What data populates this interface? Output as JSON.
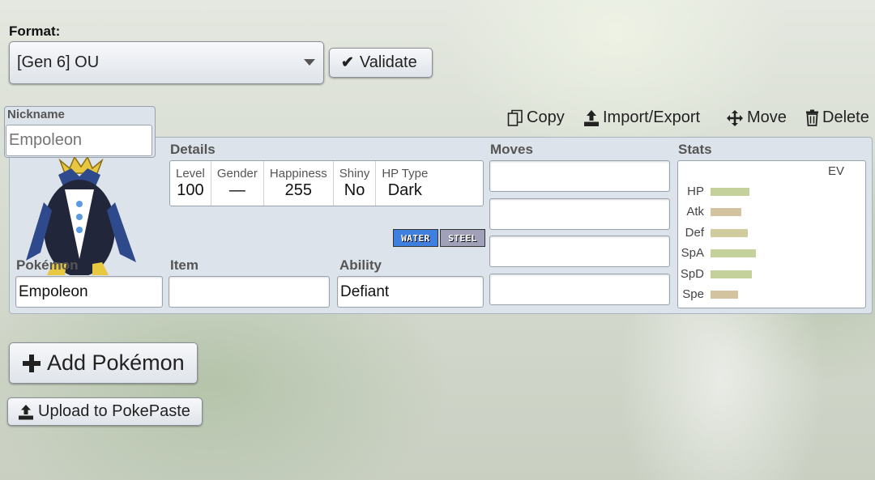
{
  "format": {
    "label": "Format:",
    "selected": "[Gen 6] OU"
  },
  "validate": {
    "label": "Validate"
  },
  "nickname": {
    "label": "Nickname",
    "placeholder": "Empoleon"
  },
  "toolbar": {
    "copy": "Copy",
    "import_export": "Import/Export",
    "move": "Move",
    "delete": "Delete"
  },
  "details": {
    "label": "Details",
    "level": {
      "label": "Level",
      "value": "100"
    },
    "gender": {
      "label": "Gender",
      "value": "—"
    },
    "happiness": {
      "label": "Happiness",
      "value": "255"
    },
    "shiny": {
      "label": "Shiny",
      "value": "No"
    },
    "hptype": {
      "label": "HP Type",
      "value": "Dark"
    }
  },
  "types": [
    {
      "name": "WATER",
      "color": "#3f7fe0"
    },
    {
      "name": "STEEL",
      "color": "#a0a0b8"
    }
  ],
  "pokemon": {
    "label": "Pokémon",
    "value": "Empoleon"
  },
  "item": {
    "label": "Item",
    "value": ""
  },
  "ability": {
    "label": "Ability",
    "value": "Defiant"
  },
  "moves": {
    "label": "Moves",
    "values": [
      "",
      "",
      "",
      ""
    ]
  },
  "stats": {
    "label": "Stats",
    "ev_header": "EV",
    "rows": [
      {
        "name": "HP",
        "level": 0.58,
        "color": "#c5d19a"
      },
      {
        "name": "Atk",
        "level": 0.46,
        "color": "#d3c39e"
      },
      {
        "name": "Def",
        "level": 0.56,
        "color": "#cfcb9c"
      },
      {
        "name": "SpA",
        "level": 0.68,
        "color": "#c5d19a"
      },
      {
        "name": "SpD",
        "level": 0.62,
        "color": "#c5d19a"
      },
      {
        "name": "Spe",
        "level": 0.42,
        "color": "#d3c39e"
      }
    ]
  },
  "add_pokemon": {
    "label": "Add Pokémon"
  },
  "upload": {
    "label": "Upload to PokePaste"
  }
}
